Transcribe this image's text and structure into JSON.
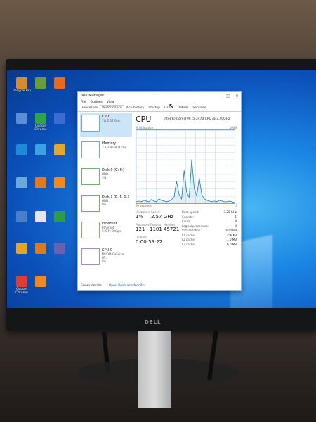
{
  "brand": "DELL",
  "desktop_icons": [
    {
      "label": "Recycle Bin",
      "color": "#d98a2b"
    },
    {
      "label": "",
      "color": "#6b9b3a"
    },
    {
      "label": "",
      "color": "#e86a1c"
    },
    {
      "label": "",
      "color": "#5a8fd6"
    },
    {
      "label": "Google Chrome",
      "color": "#2da54a"
    },
    {
      "label": "",
      "color": "#3b6dd1"
    },
    {
      "label": "",
      "color": "#1e8bd8"
    },
    {
      "label": "",
      "color": "#3aa2e0"
    },
    {
      "label": "",
      "color": "#e0a82e"
    },
    {
      "label": "",
      "color": "#6aa9d9"
    },
    {
      "label": "",
      "color": "#e07b1a"
    },
    {
      "label": "",
      "color": "#f08a1e"
    },
    {
      "label": "",
      "color": "#4a7fc9"
    },
    {
      "label": "",
      "color": "#e6e6e6"
    },
    {
      "label": "",
      "color": "#2f9a4a"
    },
    {
      "label": "",
      "color": "#f0a01e"
    },
    {
      "label": "",
      "color": "#e07a1e"
    },
    {
      "label": "",
      "color": "#6a5fb0"
    },
    {
      "label": "Google Chrome",
      "color": "#e33b2e"
    },
    {
      "label": "",
      "color": "#f08a1e"
    }
  ],
  "task_manager": {
    "title": "Task Manager",
    "controls": [
      "–",
      "□",
      "×"
    ],
    "menu": [
      "File",
      "Options",
      "View"
    ],
    "tabs": [
      "Processes",
      "Performance",
      "App history",
      "Startup",
      "Users",
      "Details",
      "Services"
    ],
    "active_tab": "Performance",
    "resources": [
      {
        "name": "CPU",
        "sub": "1% 2.57 GHz",
        "style": "sel"
      },
      {
        "name": "Memory",
        "sub": "3.2/7.9 GB (41%)",
        "style": ""
      },
      {
        "name": "Disk 0 (C: F:)",
        "sub": "HDD\n3%",
        "style": "green"
      },
      {
        "name": "Disk 1 (E: F: G:)",
        "sub": "HDD\n0%",
        "style": "green"
      },
      {
        "name": "Ethernet",
        "sub": "Ethernet\nS: 0 R: 0 Kbps",
        "style": "brown"
      },
      {
        "name": "GPU 0",
        "sub": "NVIDIA GeForce GT...\n0%",
        "style": "purple"
      }
    ],
    "main": {
      "title": "CPU",
      "model": "Intel(R) Core(TM) i5-3470 CPU @ 3.20GHz",
      "graph_label_left": "% Utilization",
      "graph_label_right": "100%",
      "graph_foot_left": "60 seconds",
      "graph_foot_right": "0",
      "utilization_label": "Utilization",
      "utilization": "1%",
      "speed_label": "Speed",
      "speed": "2.57 GHz",
      "processes_label": "Processes",
      "processes": "121",
      "threads_label": "Threads",
      "threads": "1101",
      "handles_label": "Handles",
      "handles": "45721",
      "uptime_label": "Up time",
      "uptime": "0:00:59:22",
      "props": [
        {
          "k": "Base speed:",
          "v": "3.20 GHz"
        },
        {
          "k": "Sockets:",
          "v": "1"
        },
        {
          "k": "Cores:",
          "v": "4"
        },
        {
          "k": "Logical processors:",
          "v": "4"
        },
        {
          "k": "Virtualization:",
          "v": "Disabled"
        },
        {
          "k": "L1 cache:",
          "v": "256 KB"
        },
        {
          "k": "L2 cache:",
          "v": "1.0 MB"
        },
        {
          "k": "L3 cache:",
          "v": "6.0 MB"
        }
      ]
    },
    "footer": {
      "fewer_details": "Fewer details",
      "open_monitor": "Open Resource Monitor"
    },
    "cpu_history": [
      2,
      3,
      2,
      4,
      3,
      2,
      5,
      3,
      2,
      6,
      4,
      3,
      2,
      3,
      5,
      8,
      30,
      12,
      6,
      45,
      15,
      8,
      60,
      20,
      10,
      35,
      12,
      6,
      4,
      3,
      2,
      3,
      2,
      4,
      3,
      2,
      2,
      3,
      2,
      1
    ]
  }
}
